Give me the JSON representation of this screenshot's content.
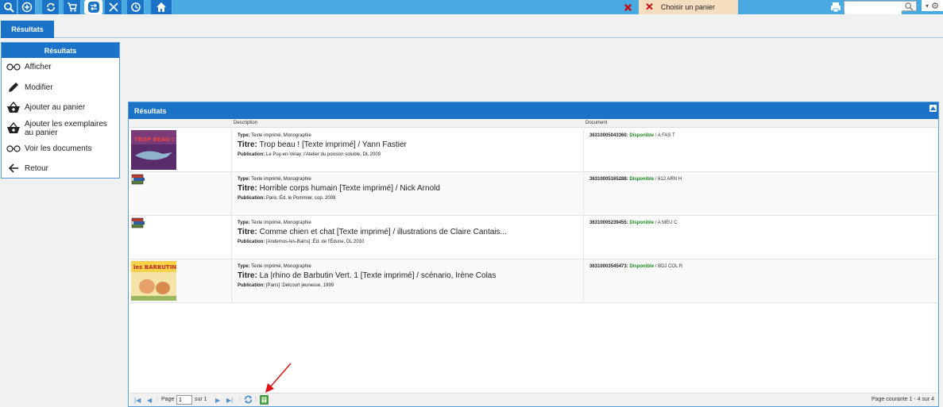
{
  "toolbar": {
    "buttons": [
      "search-icon",
      "add-icon",
      "refresh-icon",
      "basket-icon",
      "share-icon",
      "tools-icon",
      "history-icon",
      "home-icon"
    ],
    "choose_basket_label": "Choisir un panier",
    "search_placeholder": ""
  },
  "tabs": [
    {
      "label": "Résultats"
    }
  ],
  "sidemenu": {
    "title": "Résultats",
    "items": [
      {
        "label": "Afficher",
        "icon": "glasses-icon"
      },
      {
        "label": "Modifier",
        "icon": "pencil-icon"
      },
      {
        "label": "Ajouter au panier",
        "icon": "basket-add-icon"
      },
      {
        "label": "Ajouter les exemplaires au panier",
        "icon": "basket-add-icon"
      },
      {
        "label": "Voir les documents",
        "icon": "glasses-icon"
      },
      {
        "label": "Retour",
        "icon": "back-arrow-icon"
      }
    ]
  },
  "results": {
    "title": "Résultats",
    "col_description": "Description",
    "col_document": "Document",
    "rows": [
      {
        "type_label": "Type:",
        "type": "Texte imprimé, Monographie",
        "title_label": "Titre:",
        "title": "Trop beau ! [Texte imprimé] / Yann Fastier",
        "pub_label": "Publication:",
        "publication": "Le Puy-en-Velay :l'Atelier du poisson soluble, DL 2009",
        "doc_id": "36310005043360:",
        "status": "Disponible",
        "location": "/ A FAS T",
        "cover_text": "TROP BEAU !"
      },
      {
        "type_label": "Type:",
        "type": "Texte imprimé, Monographie",
        "title_label": "Titre:",
        "title": "Horrible corps humain [Texte imprimé] / Nick Arnold",
        "pub_label": "Publication:",
        "publication": "Paris :Éd. le Pommier, cop. 2009",
        "doc_id": "36310005165288:",
        "status": "Disponible",
        "location": "/ 612 ARN H"
      },
      {
        "type_label": "Type:",
        "type": "Texte imprimé, Monographie",
        "title_label": "Titre:",
        "title": "Comme chien et chat [Texte imprimé] / illustrations de Claire Cantais...",
        "pub_label": "Publication:",
        "publication": "[Andemos-les-Bains] :Éd. de l'Édune, DL 2010",
        "doc_id": "36310005239455:",
        "status": "Disponible",
        "location": "/ A MEU C"
      },
      {
        "type_label": "Type:",
        "type": "Texte imprimé, Monographie",
        "title_label": "Titre:",
        "title": "La |rhino de Barbutin Vert. 1 [Texte imprimé] / scénario, Irène Colas",
        "pub_label": "Publication:",
        "publication": "[Paris] :Delcourt jeunesse, 1999",
        "doc_id": "36310003545473:",
        "status": "Disponible",
        "location": "/ BDJ COL R",
        "cover_text": "les BARBUTINS"
      }
    ]
  },
  "pager": {
    "page_label": "Page",
    "page_value": "1",
    "of_label": "sur 1",
    "status": "Page courante 1 - 4 sur 4"
  }
}
